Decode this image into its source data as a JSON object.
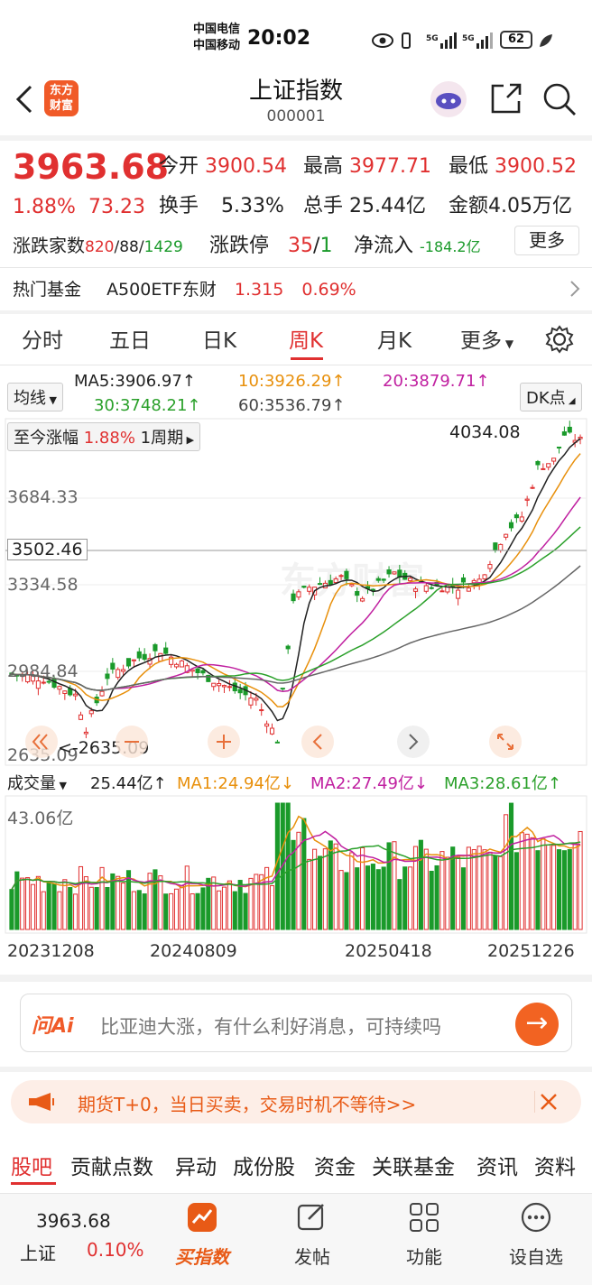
{
  "status_bar": {
    "carrier_1": "中国电信",
    "carrier_2": "中国移动",
    "time": "20:02",
    "battery": "62"
  },
  "header": {
    "title": "上证指数",
    "code": "000001",
    "logo_text": "东方财富"
  },
  "quote": {
    "price": "3963.68",
    "change_pct": "1.88%",
    "change": "73.23",
    "open_label": "今开",
    "open": "3900.54",
    "high_label": "最高",
    "high": "3977.71",
    "low_label": "最低",
    "low": "3900.52",
    "turnover_label": "换手",
    "turnover": "5.33%",
    "volume_label": "总手",
    "volume": "25.44亿",
    "amount_label": "金额",
    "amount": "4.05万亿",
    "updown_label": "涨跌家数",
    "up_count": "820",
    "sep1": "/",
    "flat_count": "88",
    "sep2": "/",
    "down_count": "1429",
    "limit_label": "涨跌停",
    "limit_up": "35",
    "limit_sep": "/",
    "limit_down": "1",
    "netflow_label": "净流入",
    "netflow": "-184.2亿",
    "more_button": "更多"
  },
  "hot_fund": {
    "label": "热门基金",
    "name": "A500ETF东财",
    "price": "1.315",
    "pct": "0.69%"
  },
  "period_tabs": [
    "分时",
    "五日",
    "日K",
    "周K",
    "月K",
    "更多"
  ],
  "active_tab": "周K",
  "ma": {
    "selector": "均线",
    "ma5": "MA5:3906.97↑",
    "ma10": "10:3926.29↑",
    "ma20": "20:3879.71↑",
    "ma30": "30:3748.21↑",
    "ma60": "60:3536.79↑",
    "dk_button": "DK点",
    "colors": {
      "ma5": "#222222",
      "ma10": "#e8900c",
      "ma20": "#c020a0",
      "ma30": "#2aa02a",
      "ma60": "#666666"
    }
  },
  "chart_overlay": {
    "gain_label": "至今涨幅",
    "gain_value": "1.88%",
    "period_label": "1周期",
    "max_label": "4034.08",
    "min_label": "<-2635.09",
    "watermark": "东方财富"
  },
  "axis": {
    "y_ticks": [
      "3684.33",
      "3334.58",
      "2984.84",
      "2635.09"
    ],
    "crosshair_value": "3502.46"
  },
  "volume": {
    "selector": "成交量",
    "vol": "25.44亿↑",
    "ma1": "MA1:24.94亿↓",
    "ma2": "MA2:27.49亿↓",
    "ma3": "MA3:28.61亿↑",
    "top_label": "43.06亿",
    "colors": {
      "ma1": "#e8900c",
      "ma2": "#c020a0",
      "ma3": "#2aa02a"
    }
  },
  "x_dates": [
    "20231208",
    "20240809",
    "20250418",
    "20251226"
  ],
  "ask": {
    "logo": "问Ai",
    "text": "比亚迪大涨，有什么利好消息，可持续吗"
  },
  "promo": {
    "text": "期货T+0，当日买卖，交易时机不等待>>"
  },
  "sub_tabs": [
    "股吧",
    "贡献点数",
    "异动",
    "成份股",
    "资金",
    "关联基金",
    "资讯",
    "资料"
  ],
  "bottom": {
    "price": "3963.68",
    "name": "上证",
    "pct": "0.10%",
    "buy_index": "买指数",
    "post": "发帖",
    "func": "功能",
    "watch": "设自选"
  },
  "chart_data": {
    "type": "candlestick",
    "period": "weekly",
    "x_start": "20231208",
    "x_end": "20251226",
    "ylim": [
      2635.09,
      4034.08
    ],
    "high_max": 4034.08,
    "low_min": 2635.09,
    "last_close": 3963.68,
    "volume_ylim": [
      0,
      43.06
    ],
    "volume_unit": "亿"
  }
}
